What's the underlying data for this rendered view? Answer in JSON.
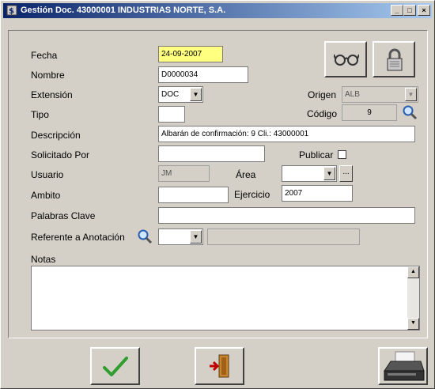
{
  "window": {
    "title": "Gestión Doc. 43000001 INDUSTRIAS NORTE, S.A.",
    "controls": {
      "minimize": "_",
      "maximize": "□",
      "close": "×"
    }
  },
  "form": {
    "fecha": {
      "label": "Fecha",
      "value": "24-09-2007"
    },
    "nombre": {
      "label": "Nombre",
      "value": "D0000034"
    },
    "extension": {
      "label": "Extensión",
      "value": "DOC"
    },
    "origen": {
      "label": "Origen",
      "value": "ALB"
    },
    "tipo": {
      "label": "Tipo",
      "value": ""
    },
    "codigo": {
      "label": "Código",
      "value": "9"
    },
    "descripcion": {
      "label": "Descripción",
      "value": "Albarán de confirmación: 9 Cli.: 43000001"
    },
    "solicitado_por": {
      "label": "Solicitado Por",
      "value": ""
    },
    "publicar": {
      "label": "Publicar"
    },
    "usuario": {
      "label": "Usuario",
      "value": "JM"
    },
    "area": {
      "label": "Área",
      "value": "",
      "button": "..."
    },
    "ambito": {
      "label": "Ambito",
      "value": ""
    },
    "ejercicio": {
      "label": "Ejercicio",
      "value": "2007"
    },
    "palabras_clave": {
      "label": "Palabras Clave",
      "value": ""
    },
    "referente": {
      "label": "Referente a Anotación",
      "value": "",
      "detail": ""
    },
    "notas": {
      "label": "Notas",
      "value": ""
    }
  },
  "icons": {
    "glasses": "glasses-icon",
    "lock": "lock-icon",
    "search": "search-icon",
    "accept": "checkmark-icon",
    "exit": "exit-door-icon",
    "scanner": "scanner-icon"
  },
  "colors": {
    "title_start": "#0a246a",
    "title_end": "#a6caf0",
    "highlight_field": "#ffff80",
    "check_green": "#2f9e2f"
  }
}
